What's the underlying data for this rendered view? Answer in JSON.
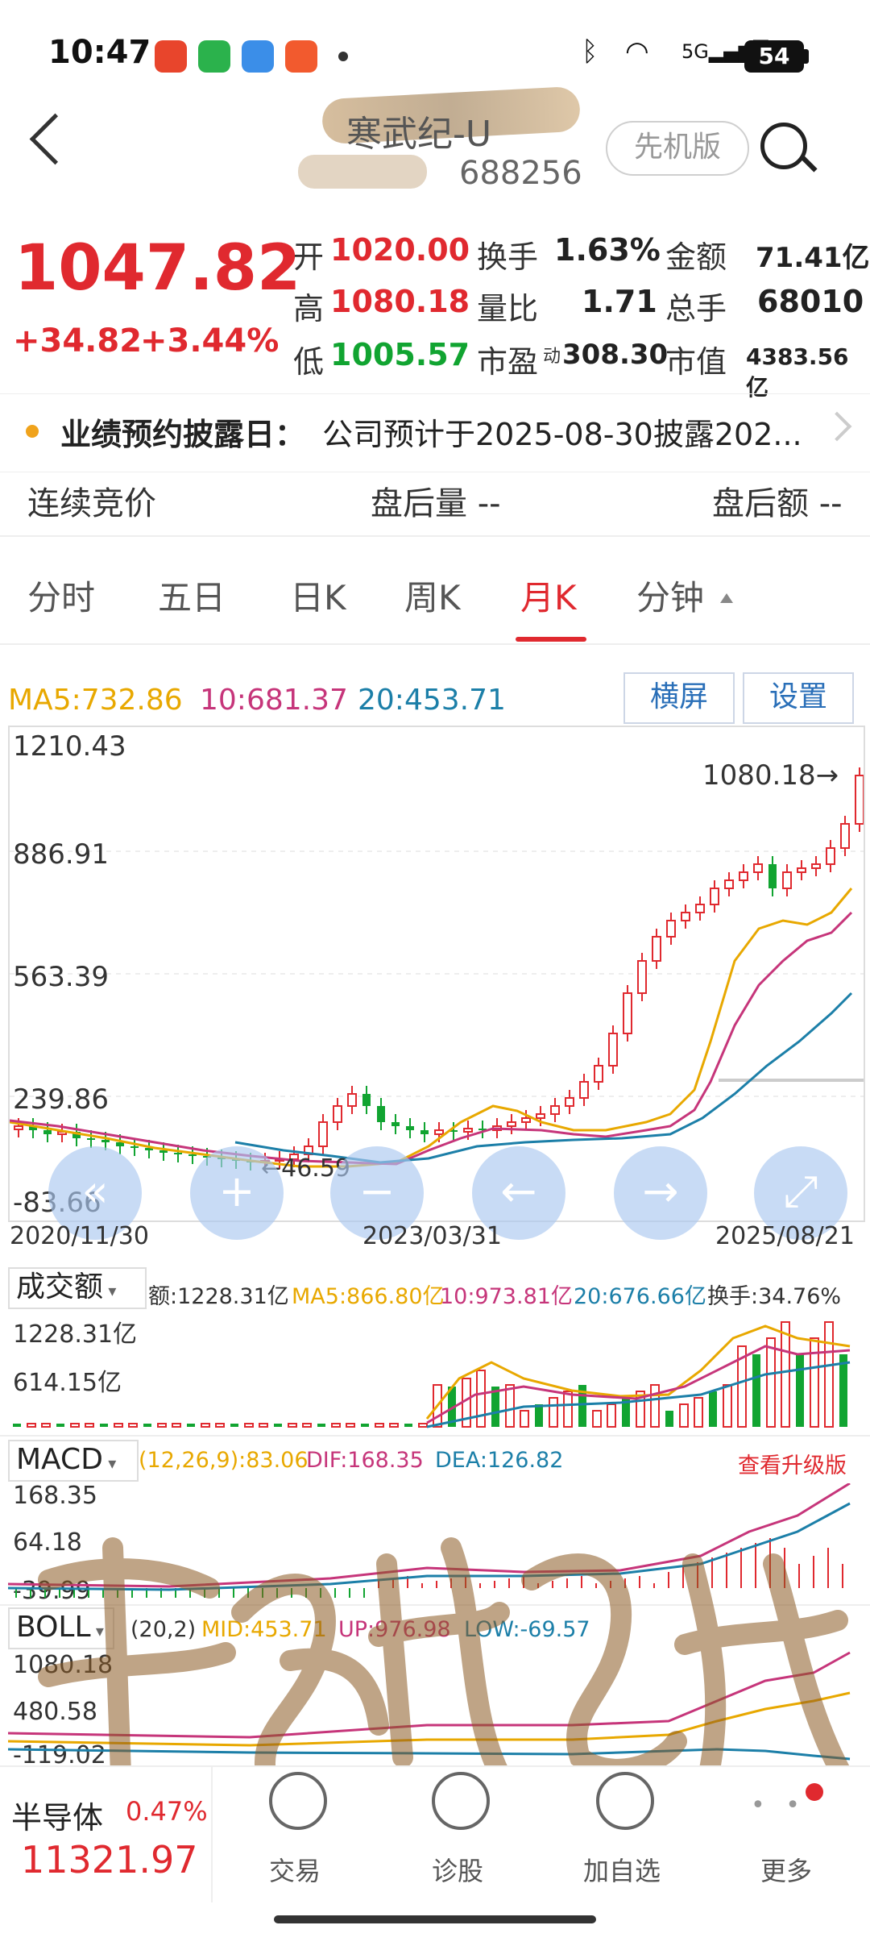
{
  "status": {
    "time": "10:47",
    "battery": "54",
    "network": "5G"
  },
  "header": {
    "name": "寒武纪-U",
    "code": "688256",
    "version_label": "先机版"
  },
  "quote": {
    "price": "1047.82",
    "change": "+34.82",
    "change_pct": "+3.44%",
    "open_label": "开",
    "open": "1020.00",
    "high_label": "高",
    "high": "1080.18",
    "low_label": "低",
    "low": "1005.57",
    "turnover_label": "换手",
    "turnover": "1.63%",
    "vol_ratio_label": "量比",
    "vol_ratio": "1.71",
    "pe_label": "市盈",
    "pe_sup": "动",
    "pe": "308.30",
    "amount_label": "金额",
    "amount": "71.41亿",
    "total_hands_label": "总手",
    "total_hands": "68010",
    "mkt_cap_label": "市值",
    "mkt_cap": "4383.56亿"
  },
  "notice": {
    "label": "业绩预约披露日：",
    "text": "公司预计于2025-08-30披露202..."
  },
  "after_hours": {
    "auction": "连续竞价",
    "volume": "盘后量 --",
    "amount": "盘后额 --"
  },
  "tabs": [
    {
      "label": "分时"
    },
    {
      "label": "五日"
    },
    {
      "label": "日K"
    },
    {
      "label": "周K"
    },
    {
      "label": "月K"
    },
    {
      "label": "分钟"
    }
  ],
  "active_tab": "月K",
  "ma": {
    "ma5": "MA5:732.86",
    "ma10": "10:681.37",
    "ma20": "20:453.71"
  },
  "chart_buttons": {
    "landscape": "横屏",
    "settings": "设置"
  },
  "kline": {
    "y_labels": [
      "1210.43",
      "886.91",
      "563.39",
      "239.86",
      "-83.66"
    ],
    "high_marker": "1080.18→",
    "low_marker": "←46.59",
    "dates": [
      "2020/11/30",
      "2023/03/31",
      "2025/08/21"
    ]
  },
  "volume_panel": {
    "selector": "成交额",
    "amount": "额:1228.31亿",
    "ma5": "MA5:866.80亿",
    "ma10": "10:973.81亿",
    "ma20": "20:676.66亿",
    "turnover": "换手:34.76%",
    "y_labels": [
      "1228.31亿",
      "614.15亿"
    ]
  },
  "macd_panel": {
    "selector": "MACD",
    "params": "(12,26,9):83.06",
    "dif": "DIF:168.35",
    "dea": "DEA:126.82",
    "upgrade": "查看升级版",
    "y_labels": [
      "168.35",
      "64.18",
      "-39.99"
    ]
  },
  "boll_panel": {
    "selector": "BOLL",
    "params": "(20,2)",
    "mid": "MID:453.71",
    "up": "UP:976.98",
    "low": "LOW:-69.57",
    "y_labels": [
      "1080.18",
      "480.58",
      "-119.02"
    ]
  },
  "bottom_bar": {
    "index_name": "半导体",
    "index_pct": "0.47%",
    "index_value": "11321.97",
    "trade": "交易",
    "diagnose": "诊股",
    "add_watch": "加自选",
    "more": "更多"
  },
  "colors": {
    "up": "#e0292f",
    "down": "#11a431",
    "ma5": "#e8a800",
    "ma10": "#c6357a",
    "ma20": "#1c7fa8"
  }
}
